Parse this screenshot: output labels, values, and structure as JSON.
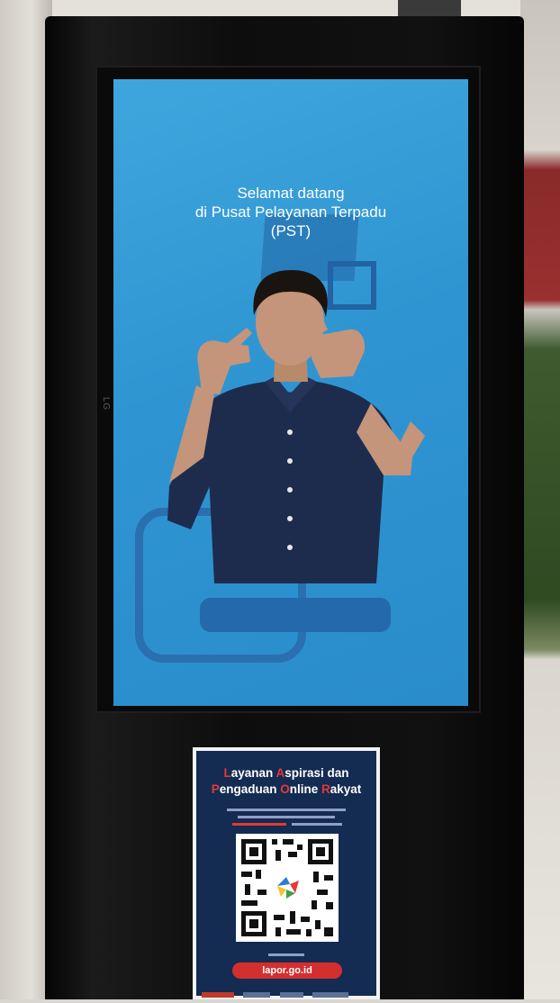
{
  "screen": {
    "title_line1": "Selamat datang",
    "title_line2": "di Pusat Pelayanan Terpadu",
    "title_line3": "(PST)"
  },
  "bezel": {
    "brand_logo": "LG"
  },
  "poster": {
    "title_line1": [
      "L",
      "ayanan ",
      "A",
      "spirasi dan"
    ],
    "title_line2": [
      "P",
      "engaduan ",
      "O",
      "nline ",
      "R",
      "akyat"
    ],
    "url": "lapor.go.id",
    "colors": {
      "background": "#142b52",
      "accent": "#e53935"
    }
  },
  "colors": {
    "screen_background": "#2f95d2",
    "decoration": "#2469ab"
  }
}
